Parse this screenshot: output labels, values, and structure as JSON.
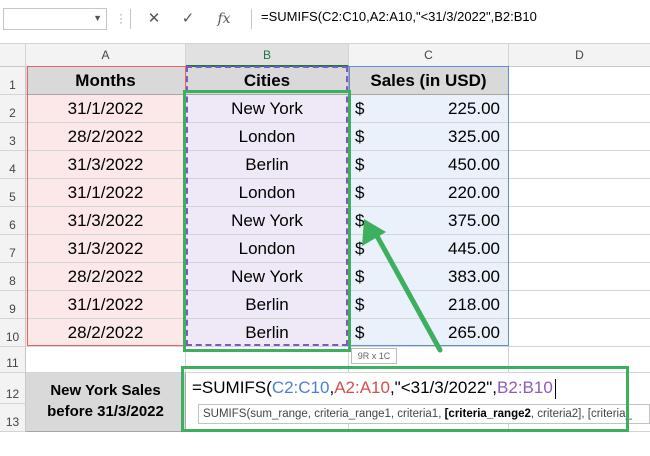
{
  "formula_bar": {
    "name_box_value": "",
    "cancel_icon": "✕",
    "enter_icon": "✓",
    "function_icon": "fx",
    "formula": "=SUMIFS(C2:C10,A2:A10,\"<31/3/2022\",B2:B10"
  },
  "columns": [
    "A",
    "B",
    "C",
    "D"
  ],
  "rows": [
    "1",
    "2",
    "3",
    "4",
    "5",
    "6",
    "7",
    "8",
    "9",
    "10",
    "11",
    "12",
    "13"
  ],
  "headers": {
    "months": "Months",
    "cities": "Cities",
    "sales": "Sales (in USD)"
  },
  "table": [
    {
      "month": "31/1/2022",
      "city": "New York",
      "currency": "$",
      "amount": "225.00"
    },
    {
      "month": "28/2/2022",
      "city": "London",
      "currency": "$",
      "amount": "325.00"
    },
    {
      "month": "31/3/2022",
      "city": "Berlin",
      "currency": "$",
      "amount": "450.00"
    },
    {
      "month": "31/1/2022",
      "city": "London",
      "currency": "$",
      "amount": "220.00"
    },
    {
      "month": "31/3/2022",
      "city": "New York",
      "currency": "$",
      "amount": "375.00"
    },
    {
      "month": "31/3/2022",
      "city": "London",
      "currency": "$",
      "amount": "445.00"
    },
    {
      "month": "28/2/2022",
      "city": "New York",
      "currency": "$",
      "amount": "383.00"
    },
    {
      "month": "31/1/2022",
      "city": "Berlin",
      "currency": "$",
      "amount": "218.00"
    },
    {
      "month": "28/2/2022",
      "city": "Berlin",
      "currency": "$",
      "amount": "265.00"
    }
  ],
  "range_size_tooltip": "9R x 1C",
  "label": {
    "line1": "New York Sales",
    "line2": "before 31/3/2022"
  },
  "edit": {
    "p1": "=SUMIFS(",
    "p2": "C2:C10",
    "p3": ",",
    "p4": "A2:A10",
    "p5": ",\"<31/3/2022\",",
    "p6": "B2:B10"
  },
  "intellisense": {
    "t1": "SUMIFS(sum_range, criteria_range1, criteria1, ",
    "t2": "[criteria_range2",
    "t3": ", criteria2], [criteria_"
  },
  "colors": {
    "annotation_green": "#3db060",
    "range_blue": "#4a7fd6",
    "range_red": "#d84c4c",
    "range_purple": "#8e5bbd"
  }
}
